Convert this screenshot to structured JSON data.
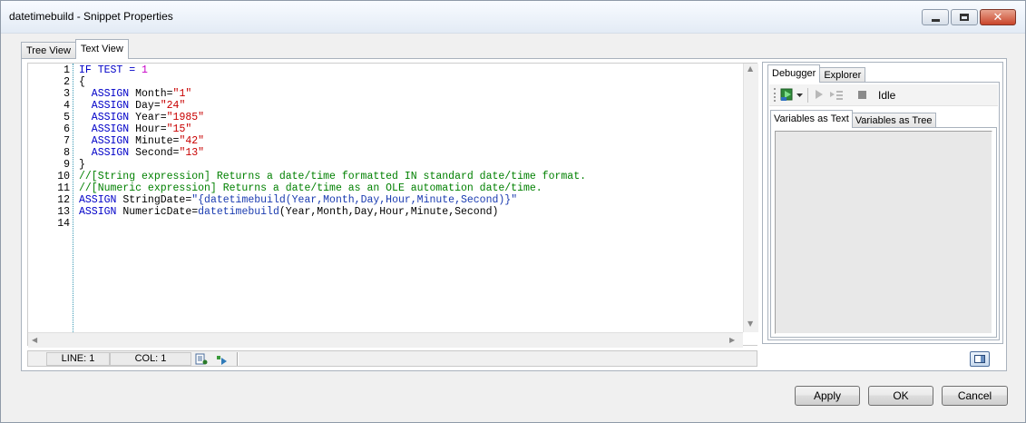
{
  "window": {
    "title": "datetimebuild - Snippet Properties",
    "controls": {
      "minimize_icon": "minimize-icon",
      "maximize_icon": "maximize-icon",
      "close_icon": "close-icon",
      "close_glyph": "✕"
    }
  },
  "main_tabs": [
    {
      "label": "Tree View",
      "active": false
    },
    {
      "label": "Text View",
      "active": true
    }
  ],
  "editor": {
    "line_numbers": [
      "1",
      "2",
      "3",
      "4",
      "5",
      "6",
      "7",
      "8",
      "9",
      "10",
      "11",
      "12",
      "13",
      "14"
    ],
    "lines": [
      [
        {
          "t": "IF TEST = ",
          "c": "kw"
        },
        {
          "t": "1",
          "c": "num"
        }
      ],
      [
        {
          "t": "{",
          "c": "plain"
        }
      ],
      [
        {
          "t": "  ASSIGN ",
          "c": "kw"
        },
        {
          "t": "Month=",
          "c": "plain"
        },
        {
          "t": "\"1\"",
          "c": "str"
        }
      ],
      [
        {
          "t": "  ASSIGN ",
          "c": "kw"
        },
        {
          "t": "Day=",
          "c": "plain"
        },
        {
          "t": "\"24\"",
          "c": "str"
        }
      ],
      [
        {
          "t": "  ASSIGN ",
          "c": "kw"
        },
        {
          "t": "Year=",
          "c": "plain"
        },
        {
          "t": "\"1985\"",
          "c": "str"
        }
      ],
      [
        {
          "t": "  ASSIGN ",
          "c": "kw"
        },
        {
          "t": "Hour=",
          "c": "plain"
        },
        {
          "t": "\"15\"",
          "c": "str"
        }
      ],
      [
        {
          "t": "  ASSIGN ",
          "c": "kw"
        },
        {
          "t": "Minute=",
          "c": "plain"
        },
        {
          "t": "\"42\"",
          "c": "str"
        }
      ],
      [
        {
          "t": "  ASSIGN ",
          "c": "kw"
        },
        {
          "t": "Second=",
          "c": "plain"
        },
        {
          "t": "\"13\"",
          "c": "str"
        }
      ],
      [
        {
          "t": "}",
          "c": "plain"
        }
      ],
      [
        {
          "t": "//[String expression] Returns a date/time formatted IN standard date/time format.",
          "c": "cmt"
        }
      ],
      [
        {
          "t": "//[Numeric expression] Returns a date/time as an OLE automation date/time.",
          "c": "cmt"
        }
      ],
      [
        {
          "t": "ASSIGN ",
          "c": "kw"
        },
        {
          "t": "StringDate=",
          "c": "plain"
        },
        {
          "t": "\"{datetimebuild(Year,Month,Day,Hour,Minute,Second)}\"",
          "c": "fn"
        }
      ],
      [
        {
          "t": "ASSIGN ",
          "c": "kw"
        },
        {
          "t": "NumericDate=",
          "c": "plain"
        },
        {
          "t": "datetimebuild",
          "c": "fn"
        },
        {
          "t": "(Year,Month,Day,Hour,Minute,Second)",
          "c": "plain"
        }
      ],
      []
    ]
  },
  "status": {
    "line_label": "LINE: 1",
    "col_label": "COL: 1",
    "icons": [
      "check-syntax-icon",
      "run-snippet-icon"
    ]
  },
  "debugger": {
    "tabs": [
      {
        "label": "Debugger",
        "active": true
      },
      {
        "label": "Explorer",
        "active": false
      }
    ],
    "toolbar_icons": [
      "start-debug-icon",
      "dropdown-arrow-icon",
      "step-icon",
      "step-over-icon",
      "stop-icon"
    ],
    "state_text": "Idle",
    "var_tabs": [
      {
        "label": "Variables as Text",
        "active": true
      },
      {
        "label": "Variables as Tree",
        "active": false
      }
    ]
  },
  "buttons": {
    "apply": "Apply",
    "ok": "OK",
    "cancel": "Cancel"
  }
}
